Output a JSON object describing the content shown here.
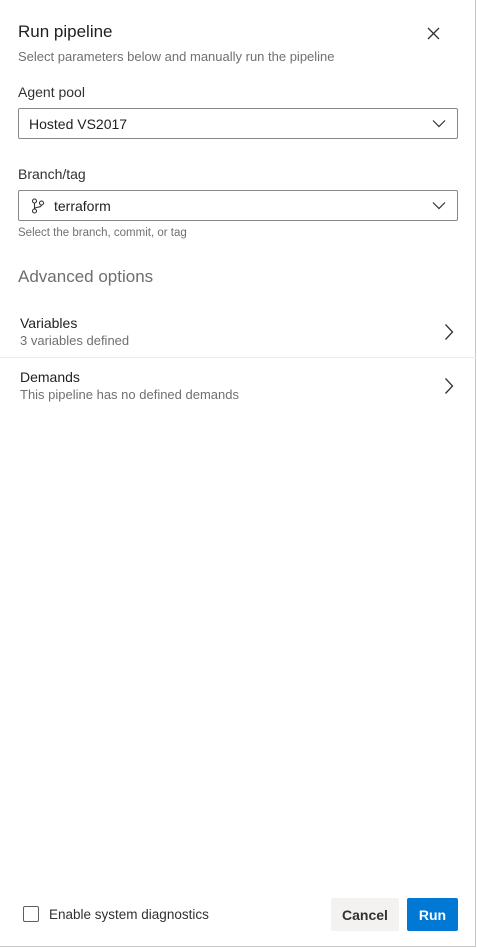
{
  "panel": {
    "title": "Run pipeline",
    "subtitle": "Select parameters below and manually run the pipeline",
    "close_icon": "close-icon"
  },
  "agent_pool": {
    "label": "Agent pool",
    "value": "Hosted VS2017",
    "icon": "chevron-down-icon"
  },
  "branch": {
    "label": "Branch/tag",
    "value": "terraform",
    "hint": "Select the branch, commit, or tag",
    "icon": "git-branch-icon"
  },
  "advanced": {
    "title": "Advanced options",
    "items": [
      {
        "title": "Variables",
        "subtitle": "3 variables defined"
      },
      {
        "title": "Demands",
        "subtitle": "This pipeline has no defined demands"
      }
    ]
  },
  "footer": {
    "diagnostics_label": "Enable system diagnostics",
    "diagnostics_checked": false,
    "cancel_label": "Cancel",
    "run_label": "Run"
  },
  "colors": {
    "primary": "#0078d4",
    "secondary_button": "#f3f2f1",
    "muted_text": "#707070"
  }
}
